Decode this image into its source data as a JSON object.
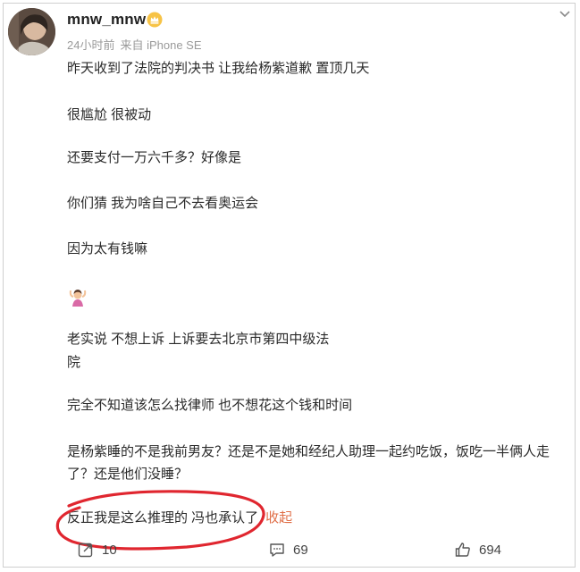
{
  "post": {
    "username": "mnw_mnw",
    "time": "24小时前",
    "source": "来自 iPhone SE",
    "lines": [
      "昨天收到了法院的判决书 让我给杨紫道歉 置顶几天",
      "很尴尬 很被动",
      "还要支付一万六千多？好像是",
      "你们猜 我为啥自己不去看奥运会",
      "因为太有钱嘛",
      "老实说 不想上诉 上诉要去北京市第四中级法",
      "院",
      "完全不知道该怎么找律师 也不想花这个钱和时间",
      "是杨紫睡的不是我前男友？还是不是她和经纪人助理一起约吃饭，饭吃一半俩人走",
      "了？还是他们没睡？",
      "反正我是这么推理的 冯也承认了"
    ],
    "fold_label": "收起",
    "emoji_icon": "person-gesturing-ok-emoji"
  },
  "actions": {
    "repost_count": "10",
    "comment_count": "69",
    "like_count": "694"
  },
  "colors": {
    "fold": "#e06f48",
    "annotation": "#e0262f",
    "meta": "#9a9a9a"
  }
}
